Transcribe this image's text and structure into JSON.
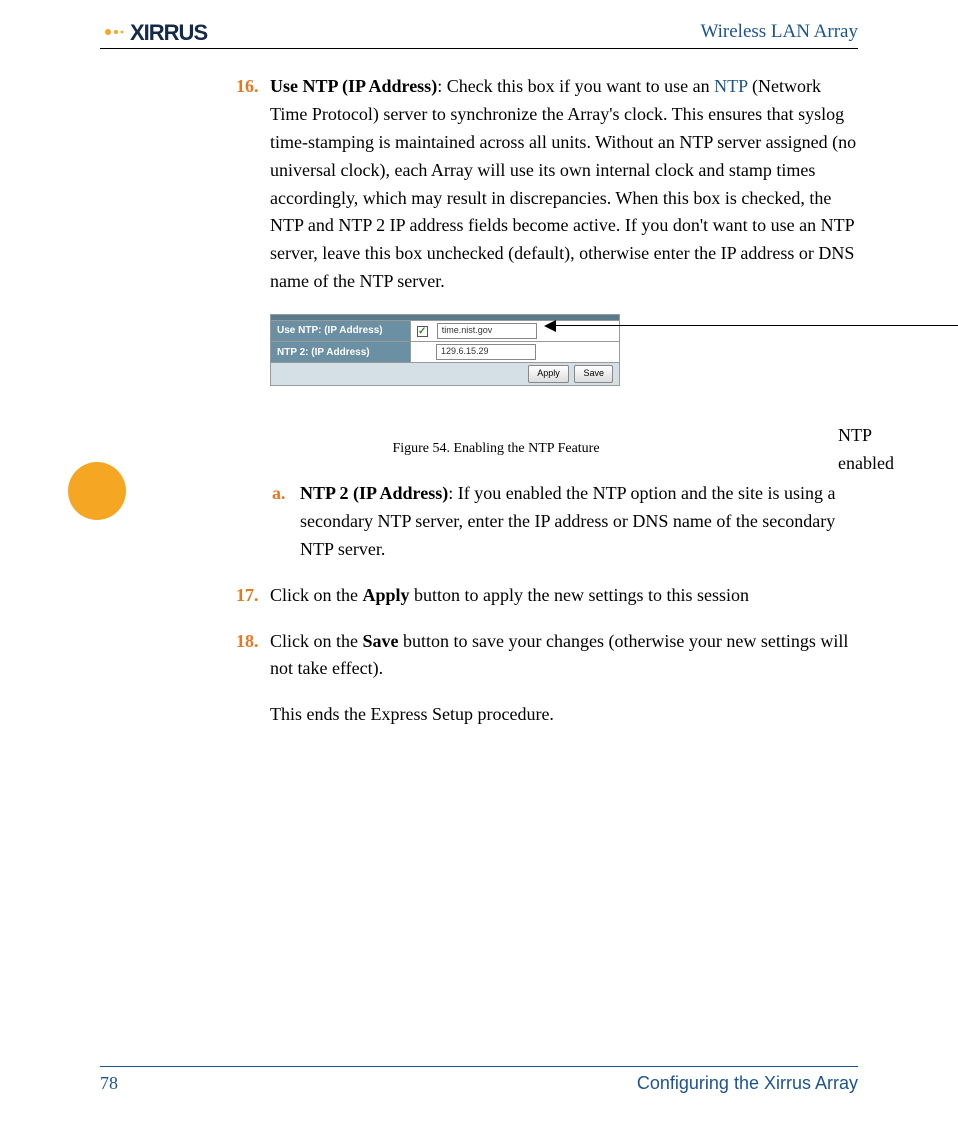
{
  "header": {
    "logo_text": "XIRRUS",
    "title": "Wireless LAN Array"
  },
  "items": {
    "i16": {
      "num": "16.",
      "title": "Use NTP (IP Address)",
      "link_word": "NTP",
      "text_before_link": ": Check this box if you want to use an ",
      "text_after_link": " (Network Time Protocol) server to synchronize the Array's clock. This ensures that syslog time-stamping is maintained across all units. Without an NTP server assigned (no universal clock), each Array will use its own internal clock and stamp times accordingly, which may result in discrepancies. When this box is checked, the NTP and NTP 2 IP address fields become active. If you don't want to use an NTP server, leave this box unchecked (default), otherwise enter the IP address or DNS name of the NTP server."
    },
    "i16a": {
      "letter": "a.",
      "title": "NTP 2 (IP Address)",
      "text": ": If you enabled the NTP option and the site is using a secondary NTP server, enter the IP address or DNS name of the secondary NTP server."
    },
    "i17": {
      "num": "17.",
      "text_before_bold": "Click on the ",
      "bold": "Apply",
      "text_after_bold": " button to apply the new settings to this session"
    },
    "i18": {
      "num": "18.",
      "text_before_bold": "Click on the ",
      "bold": "Save",
      "text_after_bold": " button to save your changes (otherwise your new settings will not take effect)."
    },
    "closing": "This ends the Express Setup procedure."
  },
  "figure": {
    "row1_label": "Use NTP: (IP Address)",
    "row1_value": "time.nist.gov",
    "row2_label": "NTP 2: (IP Address)",
    "row2_value": "129.6.15.29",
    "apply": "Apply",
    "save": "Save",
    "callout": "NTP enabled",
    "caption": "Figure 54. Enabling the NTP Feature"
  },
  "footer": {
    "page": "78",
    "section": "Configuring the Xirrus Array"
  }
}
